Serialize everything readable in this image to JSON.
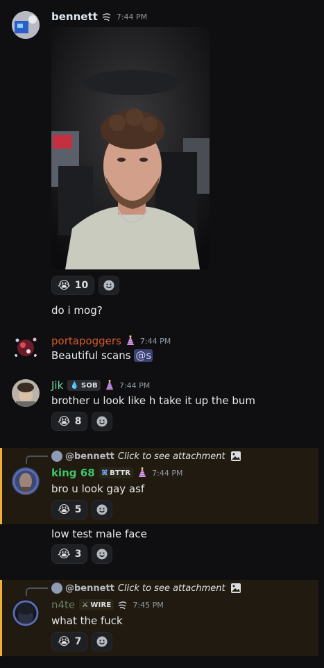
{
  "messages": {
    "m1": {
      "username": "bennett",
      "timestamp": "7:44 PM",
      "text": "do i mog?",
      "reaction": {
        "emoji": "😭",
        "count": "10"
      }
    },
    "m2": {
      "username": "portapoggers",
      "timestamp": "7:44 PM",
      "text_prefix": "Beautiful scans ",
      "mention": "@s"
    },
    "m3": {
      "username": "Jik",
      "tag": "SOB",
      "timestamp": "7:44 PM",
      "text": "brother u look like h take it up the bum",
      "reaction": {
        "emoji": "😭",
        "count": "8"
      }
    },
    "m4": {
      "reply_to": "@bennett",
      "reply_text": "Click to see attachment",
      "username": "king 68",
      "tag": "BTTR",
      "timestamp": "7:44 PM",
      "text": "bro u look gay asf",
      "reaction": {
        "emoji": "😭",
        "count": "5"
      }
    },
    "m5": {
      "text": "low test male face",
      "reaction": {
        "emoji": "😭",
        "count": "3"
      }
    },
    "m6": {
      "reply_to": "@bennett",
      "reply_text": "Click to see attachment",
      "username": "n4te",
      "tag": "WIRE",
      "timestamp": "7:45 PM",
      "text": "what the fuck",
      "reaction": {
        "emoji": "😭",
        "count": "7"
      }
    }
  },
  "colors": {
    "bennett": "#dfe7ee",
    "portapoggers": "#d4582a",
    "jik": "#6fd3a0",
    "king68": "#3fc56a",
    "n4te": "#6d7f62",
    "highlight_bar": "#f0b232"
  },
  "icons": [
    "add-reaction-icon",
    "image-icon",
    "party-hat-icon",
    "droplet-icon",
    "wind-icon"
  ]
}
